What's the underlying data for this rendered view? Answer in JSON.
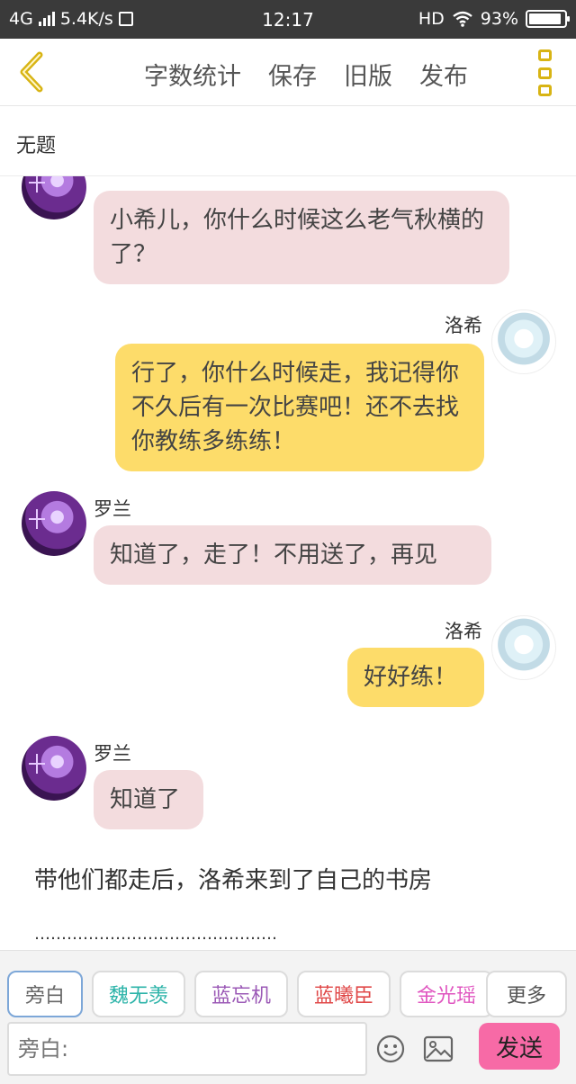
{
  "status_bar": {
    "network": "4G",
    "speed": "5.4K/s",
    "time": "12:17",
    "hd": "HD",
    "battery_percent": "93%",
    "battery_level": 0.93
  },
  "toolbar": {
    "word_count": "字数统计",
    "save": "保存",
    "old_version": "旧版",
    "publish": "发布"
  },
  "document": {
    "title": "无题"
  },
  "chat": {
    "messages": [
      {
        "speaker": "",
        "side": "left",
        "text": "小希儿，你什么时候这么老气秋横的了？"
      },
      {
        "speaker": "洛希",
        "side": "right",
        "text": "行了，你什么时候走，我记得你不久后有一次比赛吧！还不去找你教练多练练！"
      },
      {
        "speaker": "罗兰",
        "side": "left",
        "text": "知道了，走了！不用送了，再见"
      },
      {
        "speaker": "洛希",
        "side": "right",
        "text": "好好练！"
      },
      {
        "speaker": "罗兰",
        "side": "left",
        "text": "知道了"
      }
    ],
    "narration_1": "带他们都走后，洛希来到了自己的书房",
    "narration_2": "………………………………………"
  },
  "bottom": {
    "role_tabs": [
      {
        "label": "旁白",
        "color": "#666666"
      },
      {
        "label": "魏无羡",
        "color": "#2bb3a8"
      },
      {
        "label": "蓝忘机",
        "color": "#9b59b6"
      },
      {
        "label": "蓝曦臣",
        "color": "#e04848"
      },
      {
        "label": "金光瑶",
        "color": "#e056c0"
      }
    ],
    "more_label": "更多",
    "input_placeholder": "旁白:",
    "send_label": "发送"
  },
  "icons": {
    "back": "chevron-left-icon",
    "more": "more-vertical-icon",
    "emoji": "smiley-icon",
    "image": "image-icon",
    "wifi": "wifi-icon",
    "signal": "signal-icon",
    "battery": "battery-icon"
  },
  "colors": {
    "accent": "#d8b414",
    "pink_bubble": "#f3dcde",
    "yellow_bubble": "#fddc6a",
    "send": "#f76aa6"
  }
}
